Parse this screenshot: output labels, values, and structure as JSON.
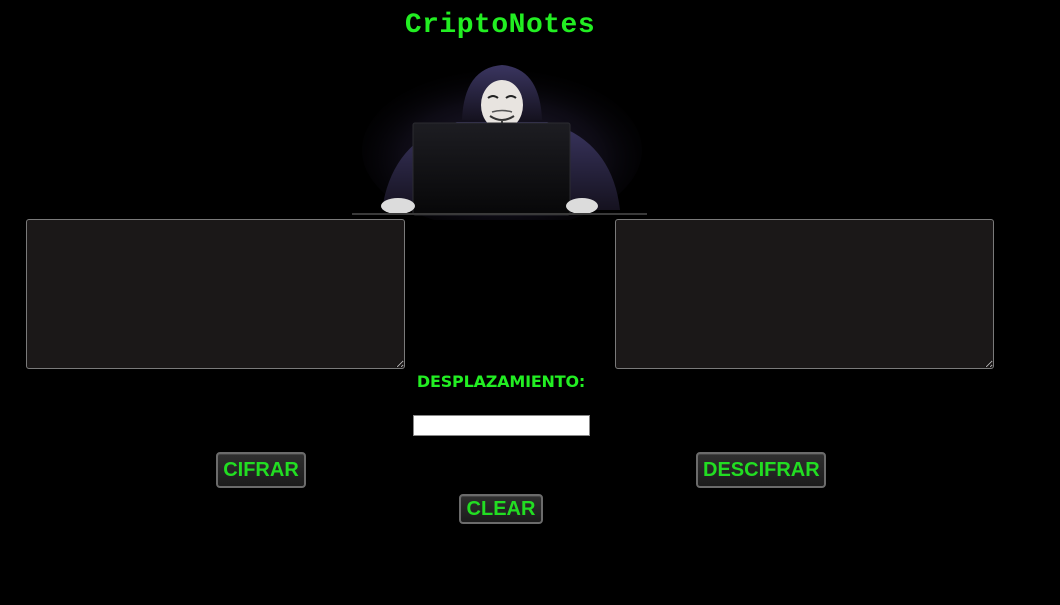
{
  "app": {
    "title": "CriptoNotes"
  },
  "hero": {
    "icon": "hacker-with-laptop-image"
  },
  "editor": {
    "left_textarea_value": "",
    "right_textarea_value": "",
    "shift_label": "DESPLAZAMIENTO:",
    "shift_value": ""
  },
  "buttons": {
    "encrypt_label": "CIFRAR",
    "decrypt_label": "DESCIFRAR",
    "clear_label": "CLEAR"
  },
  "colors": {
    "background": "#000000",
    "accent_green": "#22ee22",
    "textarea_bg": "#1b1818"
  }
}
